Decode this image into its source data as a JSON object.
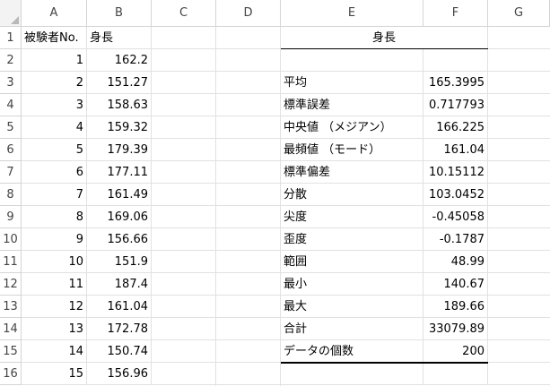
{
  "columns": [
    "A",
    "B",
    "C",
    "D",
    "E",
    "F",
    "G"
  ],
  "rows": [
    "1",
    "2",
    "3",
    "4",
    "5",
    "6",
    "7",
    "8",
    "9",
    "10",
    "11",
    "12",
    "13",
    "14",
    "15",
    "16"
  ],
  "col_a": [
    "被験者No.",
    "1",
    "2",
    "3",
    "4",
    "5",
    "6",
    "7",
    "8",
    "9",
    "10",
    "11",
    "12",
    "13",
    "14",
    "15"
  ],
  "col_b": [
    "身長",
    "162.2",
    "151.27",
    "158.63",
    "159.32",
    "179.39",
    "177.11",
    "161.49",
    "169.06",
    "156.66",
    "151.9",
    "187.4",
    "161.04",
    "172.78",
    "150.74",
    "156.96"
  ],
  "stats": {
    "header": "身長",
    "labels": [
      "平均",
      "標準誤差",
      "中央値 （メジアン）",
      "最頻値 （モード）",
      "標準偏差",
      "分散",
      "尖度",
      "歪度",
      "範囲",
      "最小",
      "最大",
      "合計",
      "データの個数"
    ],
    "values": [
      "165.3995",
      "0.717793",
      "166.225",
      "161.04",
      "10.15112",
      "103.0452",
      "-0.45058",
      "-0.1787",
      "48.99",
      "140.67",
      "189.66",
      "33079.89",
      "200"
    ]
  }
}
